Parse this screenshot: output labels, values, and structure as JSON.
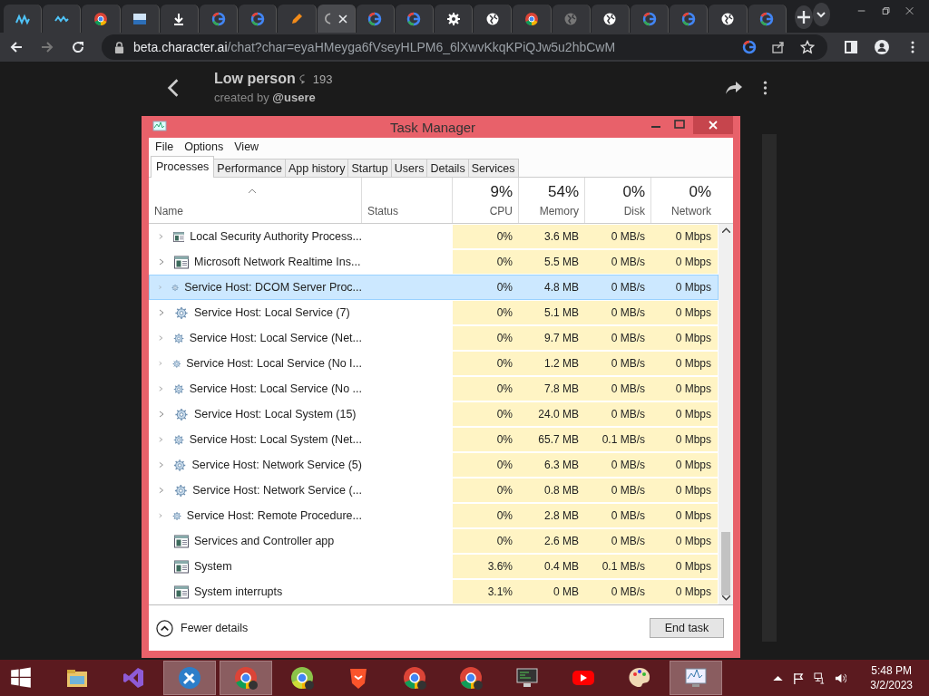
{
  "browser": {
    "tabs": [
      {
        "kind": "mlogo",
        "selected": false
      },
      {
        "kind": "wave",
        "selected": false
      },
      {
        "kind": "chrome",
        "selected": false
      },
      {
        "kind": "bitview",
        "selected": false
      },
      {
        "kind": "download",
        "selected": false
      },
      {
        "kind": "google",
        "selected": false
      },
      {
        "kind": "google",
        "selected": false
      },
      {
        "kind": "pencil",
        "selected": false
      },
      {
        "kind": "spinner",
        "selected": true
      },
      {
        "kind": "google",
        "selected": false
      },
      {
        "kind": "google",
        "selected": false
      },
      {
        "kind": "gear",
        "selected": false
      },
      {
        "kind": "globe",
        "selected": false
      },
      {
        "kind": "chrome",
        "selected": false
      },
      {
        "kind": "dimglobe",
        "selected": false
      },
      {
        "kind": "globe",
        "selected": false
      },
      {
        "kind": "google",
        "selected": false
      },
      {
        "kind": "google",
        "selected": false
      },
      {
        "kind": "globe",
        "selected": false
      },
      {
        "kind": "google",
        "selected": false
      }
    ],
    "url_host": "beta.character.ai",
    "url_path": "/chat?char=eyaHMeyga6fVseyHLPM6_6lXwvKkqKPiQJw5u2hbCwM"
  },
  "chat": {
    "title": "Low person",
    "count": "193",
    "created_by": "created by",
    "author": "@usere"
  },
  "task_manager": {
    "title": "Task Manager",
    "menu": [
      "File",
      "Options",
      "View"
    ],
    "tabs": [
      {
        "label": "Processes",
        "selected": true
      },
      {
        "label": "Performance",
        "selected": false
      },
      {
        "label": "App history",
        "selected": false
      },
      {
        "label": "Startup",
        "selected": false
      },
      {
        "label": "Users",
        "selected": false
      },
      {
        "label": "Details",
        "selected": false
      },
      {
        "label": "Services",
        "selected": false
      }
    ],
    "columns": [
      {
        "label": "Name"
      },
      {
        "label": "Status"
      },
      {
        "label": "CPU",
        "total": "9%"
      },
      {
        "label": "Memory",
        "total": "54%"
      },
      {
        "label": "Disk",
        "total": "0%"
      },
      {
        "label": "Network",
        "total": "0%"
      }
    ],
    "rows": [
      {
        "name": "Local Security Authority Process...",
        "kind": "window",
        "expandable": true,
        "selected": false,
        "cpu": "0%",
        "memory": "3.6 MB",
        "disk": "0 MB/s",
        "network": "0 Mbps"
      },
      {
        "name": "Microsoft Network Realtime Ins...",
        "kind": "window",
        "expandable": true,
        "selected": false,
        "cpu": "0%",
        "memory": "5.5 MB",
        "disk": "0 MB/s",
        "network": "0 Mbps"
      },
      {
        "name": "Service Host: DCOM Server Proc...",
        "kind": "gear",
        "expandable": true,
        "selected": true,
        "cpu": "0%",
        "memory": "4.8 MB",
        "disk": "0 MB/s",
        "network": "0 Mbps"
      },
      {
        "name": "Service Host: Local Service (7)",
        "kind": "gear",
        "expandable": true,
        "selected": false,
        "cpu": "0%",
        "memory": "5.1 MB",
        "disk": "0 MB/s",
        "network": "0 Mbps"
      },
      {
        "name": "Service Host: Local Service (Net...",
        "kind": "gear",
        "expandable": true,
        "selected": false,
        "cpu": "0%",
        "memory": "9.7 MB",
        "disk": "0 MB/s",
        "network": "0 Mbps"
      },
      {
        "name": "Service Host: Local Service (No I...",
        "kind": "gear",
        "expandable": true,
        "selected": false,
        "cpu": "0%",
        "memory": "1.2 MB",
        "disk": "0 MB/s",
        "network": "0 Mbps"
      },
      {
        "name": "Service Host: Local Service (No ...",
        "kind": "gear",
        "expandable": true,
        "selected": false,
        "cpu": "0%",
        "memory": "7.8 MB",
        "disk": "0 MB/s",
        "network": "0 Mbps"
      },
      {
        "name": "Service Host: Local System (15)",
        "kind": "gear",
        "expandable": true,
        "selected": false,
        "cpu": "0%",
        "memory": "24.0 MB",
        "disk": "0 MB/s",
        "network": "0 Mbps"
      },
      {
        "name": "Service Host: Local System (Net...",
        "kind": "gear",
        "expandable": true,
        "selected": false,
        "cpu": "0%",
        "memory": "65.7 MB",
        "disk": "0.1 MB/s",
        "network": "0 Mbps"
      },
      {
        "name": "Service Host: Network Service (5)",
        "kind": "gear",
        "expandable": true,
        "selected": false,
        "cpu": "0%",
        "memory": "6.3 MB",
        "disk": "0 MB/s",
        "network": "0 Mbps"
      },
      {
        "name": "Service Host: Network Service (...",
        "kind": "gear",
        "expandable": true,
        "selected": false,
        "cpu": "0%",
        "memory": "0.8 MB",
        "disk": "0 MB/s",
        "network": "0 Mbps"
      },
      {
        "name": "Service Host: Remote Procedure...",
        "kind": "gear",
        "expandable": true,
        "selected": false,
        "cpu": "0%",
        "memory": "2.8 MB",
        "disk": "0 MB/s",
        "network": "0 Mbps"
      },
      {
        "name": "Services and Controller app",
        "kind": "window",
        "expandable": false,
        "selected": false,
        "cpu": "0%",
        "memory": "2.6 MB",
        "disk": "0 MB/s",
        "network": "0 Mbps"
      },
      {
        "name": "System",
        "kind": "window",
        "expandable": false,
        "selected": false,
        "cpu": "3.6%",
        "memory": "0.4 MB",
        "disk": "0.1 MB/s",
        "network": "0 Mbps"
      },
      {
        "name": "System interrupts",
        "kind": "window",
        "expandable": false,
        "selected": false,
        "cpu": "3.1%",
        "memory": "0 MB",
        "disk": "0 MB/s",
        "network": "0 Mbps"
      }
    ],
    "fewer_details": "Fewer details",
    "end_task": "End task"
  },
  "taskbar": {
    "apps": [
      {
        "kind": "folder",
        "active": false
      },
      {
        "kind": "studio",
        "active": false
      },
      {
        "kind": "tools",
        "active": true
      },
      {
        "kind": "chrome",
        "active": true
      },
      {
        "kind": "greenchrome",
        "active": false
      },
      {
        "kind": "lion",
        "active": false
      },
      {
        "kind": "chrome",
        "active": false
      },
      {
        "kind": "chrome",
        "active": false
      },
      {
        "kind": "monitor",
        "active": false
      },
      {
        "kind": "youtube",
        "active": false
      },
      {
        "kind": "palette",
        "active": false
      },
      {
        "kind": "taskmanager",
        "active": true
      }
    ],
    "time": "5:48 PM",
    "date": "3/2/2023"
  }
}
